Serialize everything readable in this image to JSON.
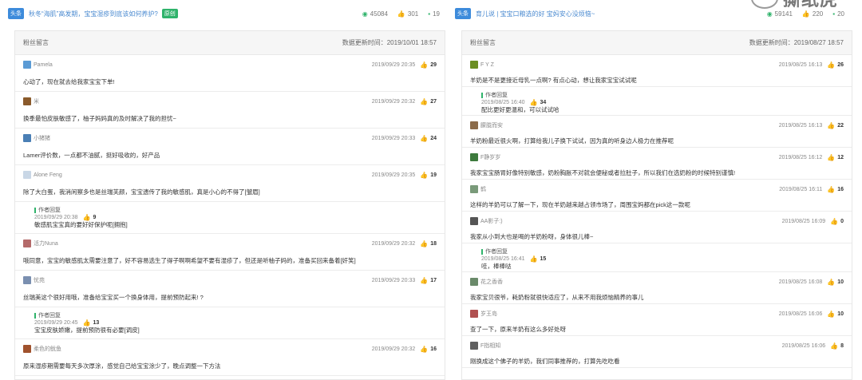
{
  "left": {
    "tag": "头条",
    "title": "秋冬“海肌”高发期，宝宝湿疹到底该如何养护?",
    "origin": "原创",
    "views": "45084",
    "likes": "301",
    "comments": "19",
    "panel_title": "粉丝留言",
    "update_label": "数据更新时间：2019/10/01 18:57",
    "comments_list": [
      {
        "user": "Pamela",
        "time": "2019/09/29 20:35",
        "likes": "29",
        "text": "心动了，现在就去给我家宝宝下单!",
        "avatar_color": "#5b9bd5"
      },
      {
        "user": "米",
        "time": "2019/09/29 20:32",
        "likes": "27",
        "text": "换季最怕皮肤敏感了，柚子妈妈真的及时解决了我的担忧~",
        "avatar_color": "#8a5a2b"
      },
      {
        "user": "小猪猪",
        "time": "2019/09/29 20:33",
        "likes": "24",
        "text": "Lamer评价数，一点都不油腻，挺好吸收的，好产品",
        "avatar_color": "#4a7fb5"
      },
      {
        "user": "Alone Feng",
        "time": "2019/09/29 20:35",
        "likes": "19",
        "text": "除了大白蛋，我消闲察多也是丝瑞芙颜，宝宝遗传了我的敏感肌，真是小心的不得了[皱眉]",
        "avatar_color": "#c9d7e6",
        "reply": {
          "label": "作者回复",
          "time": "2019/09/29 20:38",
          "likes": "9",
          "text": "敏感肌宝宝真的要好好保护呢[拥抱]"
        }
      },
      {
        "user": "活力Nuna",
        "time": "2019/09/29 20:32",
        "likes": "18",
        "text": "哦同意，宝宝的敏感肌太需要注意了，好不容易选生了得子啊啊希望不要有湿疹了，但还是听柚子妈的，准备买回来备着[奸笑]",
        "avatar_color": "#b46a6a"
      },
      {
        "user": "忧苑",
        "time": "2019/09/29 20:33",
        "likes": "17",
        "text": "丝瑞美这个很好用哦，准备给宝宝买一个換身体用，提前预防起来! ?",
        "avatar_color": "#7a8fb0",
        "reply": {
          "label": "作者回复",
          "time": "2019/09/29 20:45",
          "likes": "13",
          "text": "宝宝皮肤娇嫩，提前预防很有必要[调皮]"
        }
      },
      {
        "user": "柔色的鱿鱼",
        "time": "2019/09/29 20:32",
        "likes": "16",
        "text": "原来湿疹期需要每天多次厚涂，感觉自己给宝宝涂少了，晚点调整一下方法",
        "avatar_color": "#a0522d"
      }
    ]
  },
  "right": {
    "tag": "头条",
    "title": "育儿说 | 宝宝口粮选的好  宝妈安心没烦恼~",
    "views": "59141",
    "likes": "220",
    "comments": "20",
    "panel_title": "粉丝留言",
    "update_label": "数据更新时间：2019/08/27 18:57",
    "comments_list": [
      {
        "user": "F Y Z",
        "time": "2019/08/25 16:13",
        "likes": "26",
        "text": "羊奶是不是更接近母乳一点啊? 有点心动，想让我家宝宝试试呢",
        "avatar_color": "#6b8e23",
        "reply": {
          "label": "作者回复",
          "time": "2019/08/25 16:40",
          "likes": "34",
          "text": "配比更好更温和，可以试试哈"
        }
      },
      {
        "user": "朦胧而安",
        "time": "2019/08/25 16:13",
        "likes": "22",
        "text": "羊奶粉最近很火啊，打算给我儿子换下试试，因为真的听身边人极力在推荐呢",
        "avatar_color": "#8b6b4a"
      },
      {
        "user": "F静岁岁",
        "time": "2019/08/25 16:12",
        "likes": "12",
        "text": "我家宝宝肠胃好像特别敏感，奶粉胸胀不对就会便秘或者拉肚子，所以我们在选奶粉的时候特别谨慎!",
        "avatar_color": "#3d7a3d"
      },
      {
        "user": "鹤",
        "time": "2019/08/25 16:11",
        "likes": "16",
        "text": "这样的羊奶可以了解一下，现在羊奶越来越占领市场了，周围宝妈都在pick这一款呢",
        "avatar_color": "#7a9a7a"
      },
      {
        "user": "AA影子:)",
        "time": "2019/08/25 16:09",
        "likes": "0",
        "text": "我家从小到大也是喝的羊奶粉呀，身体很儿棒~",
        "avatar_color": "#555555",
        "reply": {
          "label": "作者回复",
          "time": "2019/08/25 16:41",
          "likes": "15",
          "text": "哇，棒棒哒"
        }
      },
      {
        "user": "花之香香",
        "time": "2019/08/25 16:08",
        "likes": "10",
        "text": "我家宝贝很爷，耗奶粉就很快适应了，从来不用我烦恼精养的事儿",
        "avatar_color": "#6a8a6a"
      },
      {
        "user": "岁王岛",
        "time": "2019/08/25 16:06",
        "likes": "10",
        "text": "查了一下，原来羊奶有这么多好处呀",
        "avatar_color": "#b05050"
      },
      {
        "user": "F指相知",
        "time": "2019/08/25 16:06",
        "likes": "8",
        "text": "刚换成这个佛子的羊奶，我们同事推荐的，打算先吃吃看",
        "avatar_color": "#606060"
      }
    ]
  },
  "watermark": "撕纸虎",
  "colors": {
    "accent_blue": "#3d8bdb",
    "accent_green": "#2fb36b"
  }
}
